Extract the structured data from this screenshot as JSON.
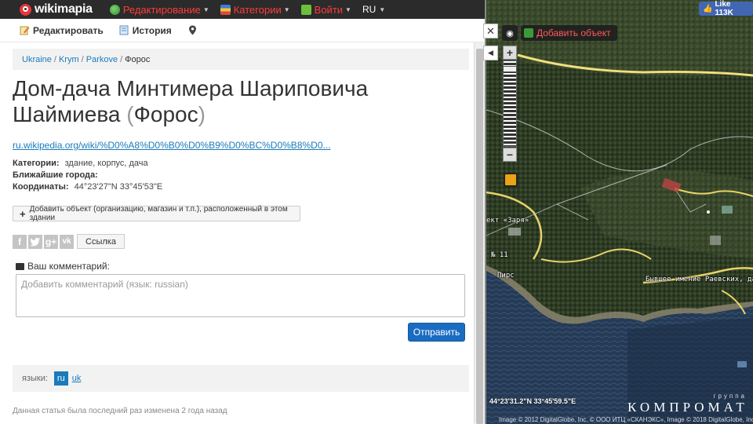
{
  "topbar": {
    "logo": "wikimapia",
    "nav": [
      {
        "label": "Редактирование",
        "icon": "globe-icon"
      },
      {
        "label": "Категории",
        "icon": "categories-icon"
      },
      {
        "label": "Войти",
        "icon": "login-icon"
      }
    ],
    "lang": "RU"
  },
  "toolbar": {
    "edit_label": "Редактировать",
    "history_label": "История"
  },
  "breadcrumb": [
    "Ukraine",
    "Krym",
    "Parkove"
  ],
  "breadcrumb_current": "Форос",
  "page": {
    "title_main": "Дом-дача Минтимера Шариповича Шаймиева",
    "title_place": "Форос",
    "wiki_link": "ru.wikipedia.org/wiki/%D0%A8%D0%B0%D0%B9%D0%BC%D0%B8%D0...",
    "categories_label": "Категории:",
    "categories_value": "здание, корпус,  дача",
    "nearest_label": "Ближайшие города:",
    "coords_label": "Координаты:",
    "coords_value": "44°23'27\"N 33°45'53\"E",
    "add_object_label": "Добавить объект (организацию, магазин и т.п.), расположенный в этом здании",
    "share_link_label": "Ссылка",
    "comment_label": "Ваш комментарий:",
    "comment_placeholder": "Добавить комментарий (язык: russian)",
    "send_label": "Отправить",
    "langs_label": "языки:",
    "lang_current": "ru",
    "lang_other": "uk",
    "modified_text": "Данная статья была последний раз изменена 2 года назад"
  },
  "map": {
    "add_object_label": "Добавить объект",
    "fb_like": "Like 113K",
    "labels": {
      "zarya": "ект «Заря»",
      "n11": "№ 11",
      "pier": "Пирс",
      "raevsky": "Бывшее имение Раевских, дач"
    },
    "coordinates": "44°23'31.2\"N 33°45'59.5\"E",
    "copyright": "Image © 2012 DigitalGlobe, Inc. © ООО ИТЦ «СКАНЭКС», Image © 2018 DigitalGlobe, Inc.",
    "watermark_small": "группа",
    "watermark_big": "КОМПРОМАТ"
  },
  "colors": {
    "topbar_bg": "#2b2b2b",
    "nav_red": "#ff3b3b",
    "link_blue": "#1a7bb9",
    "send_blue": "#1a6cc2"
  }
}
